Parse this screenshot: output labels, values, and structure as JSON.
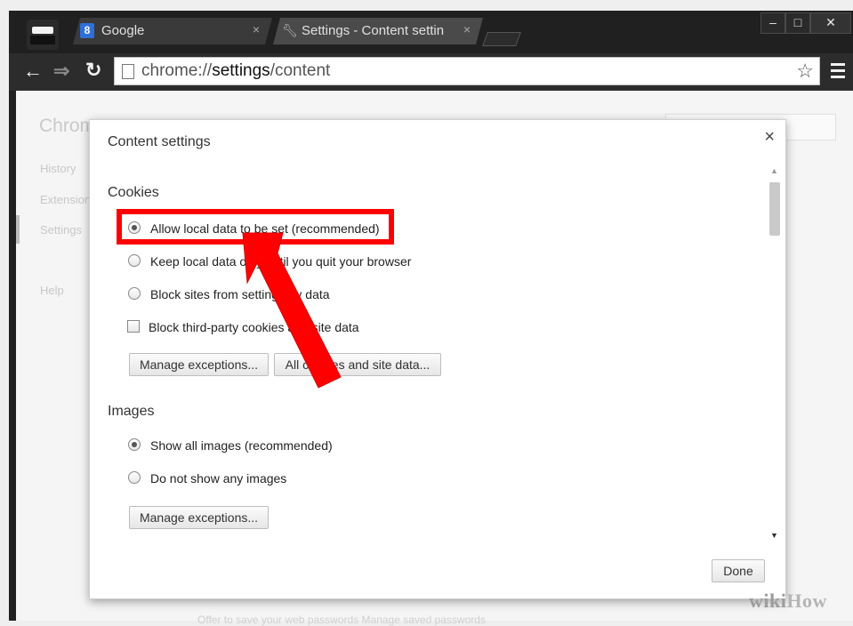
{
  "browser": {
    "tabs": [
      {
        "label": "Google",
        "close": "×",
        "icon": "google-favicon"
      },
      {
        "label": "Settings - Content setting",
        "close": "×",
        "icon": "wrench-icon"
      }
    ],
    "window_controls": {
      "minimize": "‒",
      "maximize": "□",
      "close": "✕"
    },
    "address": {
      "prefix": "chrome://",
      "host": "settings",
      "path": "/content"
    }
  },
  "background_page": {
    "title": "Chrom",
    "nav": [
      "History",
      "Extension",
      "Settings",
      "Help"
    ],
    "footer": "Offer to save your web passwords   Manage saved passwords"
  },
  "dialog": {
    "title": "Content settings",
    "close": "×",
    "sections": {
      "cookies": {
        "heading": "Cookies",
        "options": [
          {
            "label": "Allow local data to be set (recommended)",
            "selected": true
          },
          {
            "label": "Keep local data only until you quit your browser",
            "selected": false
          },
          {
            "label": "Block sites from setting any data",
            "selected": false
          }
        ],
        "checkbox": {
          "label": "Block third-party cookies and site data",
          "checked": false
        },
        "buttons": [
          "Manage exceptions...",
          "All cookies and site data..."
        ]
      },
      "images": {
        "heading": "Images",
        "options": [
          {
            "label": "Show all images (recommended)",
            "selected": true
          },
          {
            "label": "Do not show any images",
            "selected": false
          }
        ],
        "buttons": [
          "Manage exceptions..."
        ]
      }
    },
    "done": "Done"
  },
  "annotation": {
    "highlight_color": "#ff0000",
    "arrow_color": "#ff0000"
  },
  "watermark": {
    "wiki": "wiki",
    "how": "How"
  }
}
